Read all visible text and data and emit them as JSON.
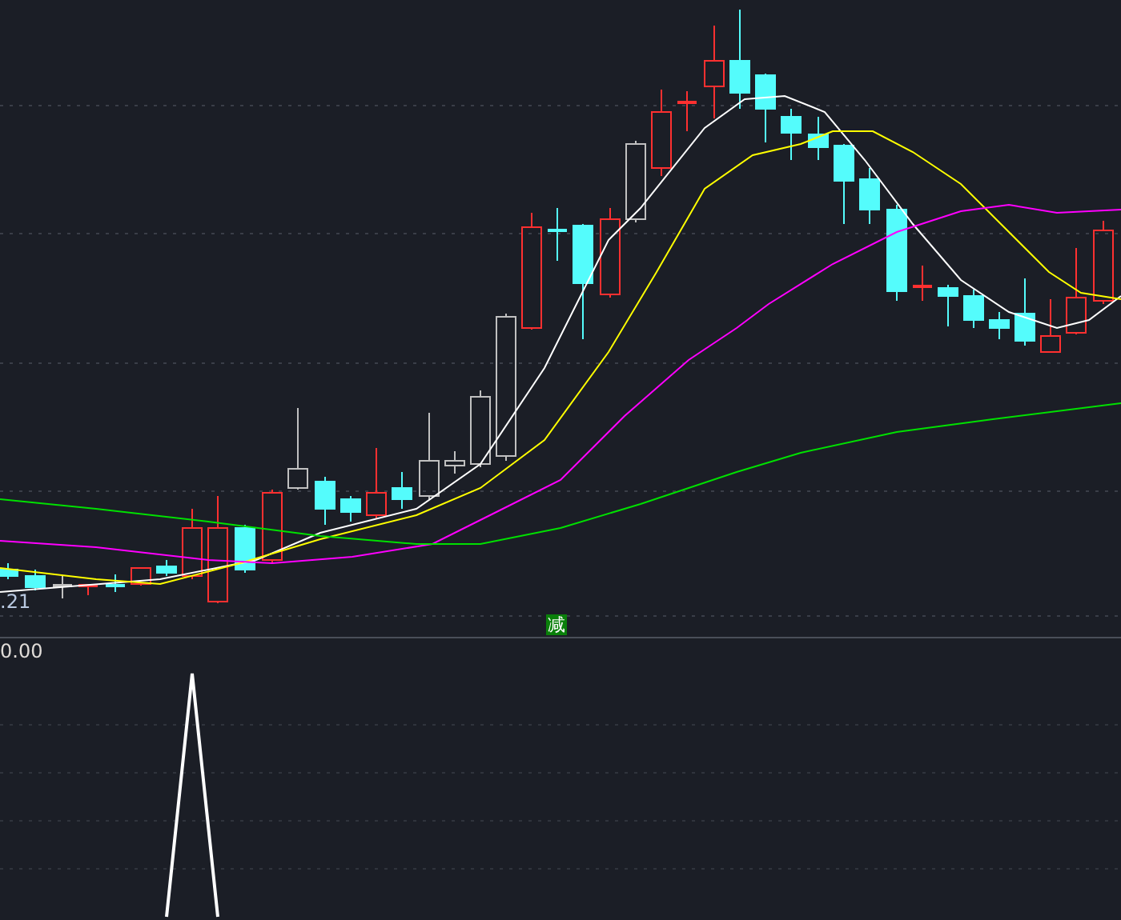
{
  "main_panel": {
    "price_label": ".21",
    "signal_badge": "减"
  },
  "indicator_panel": {
    "value_label": "0.00"
  }
}
